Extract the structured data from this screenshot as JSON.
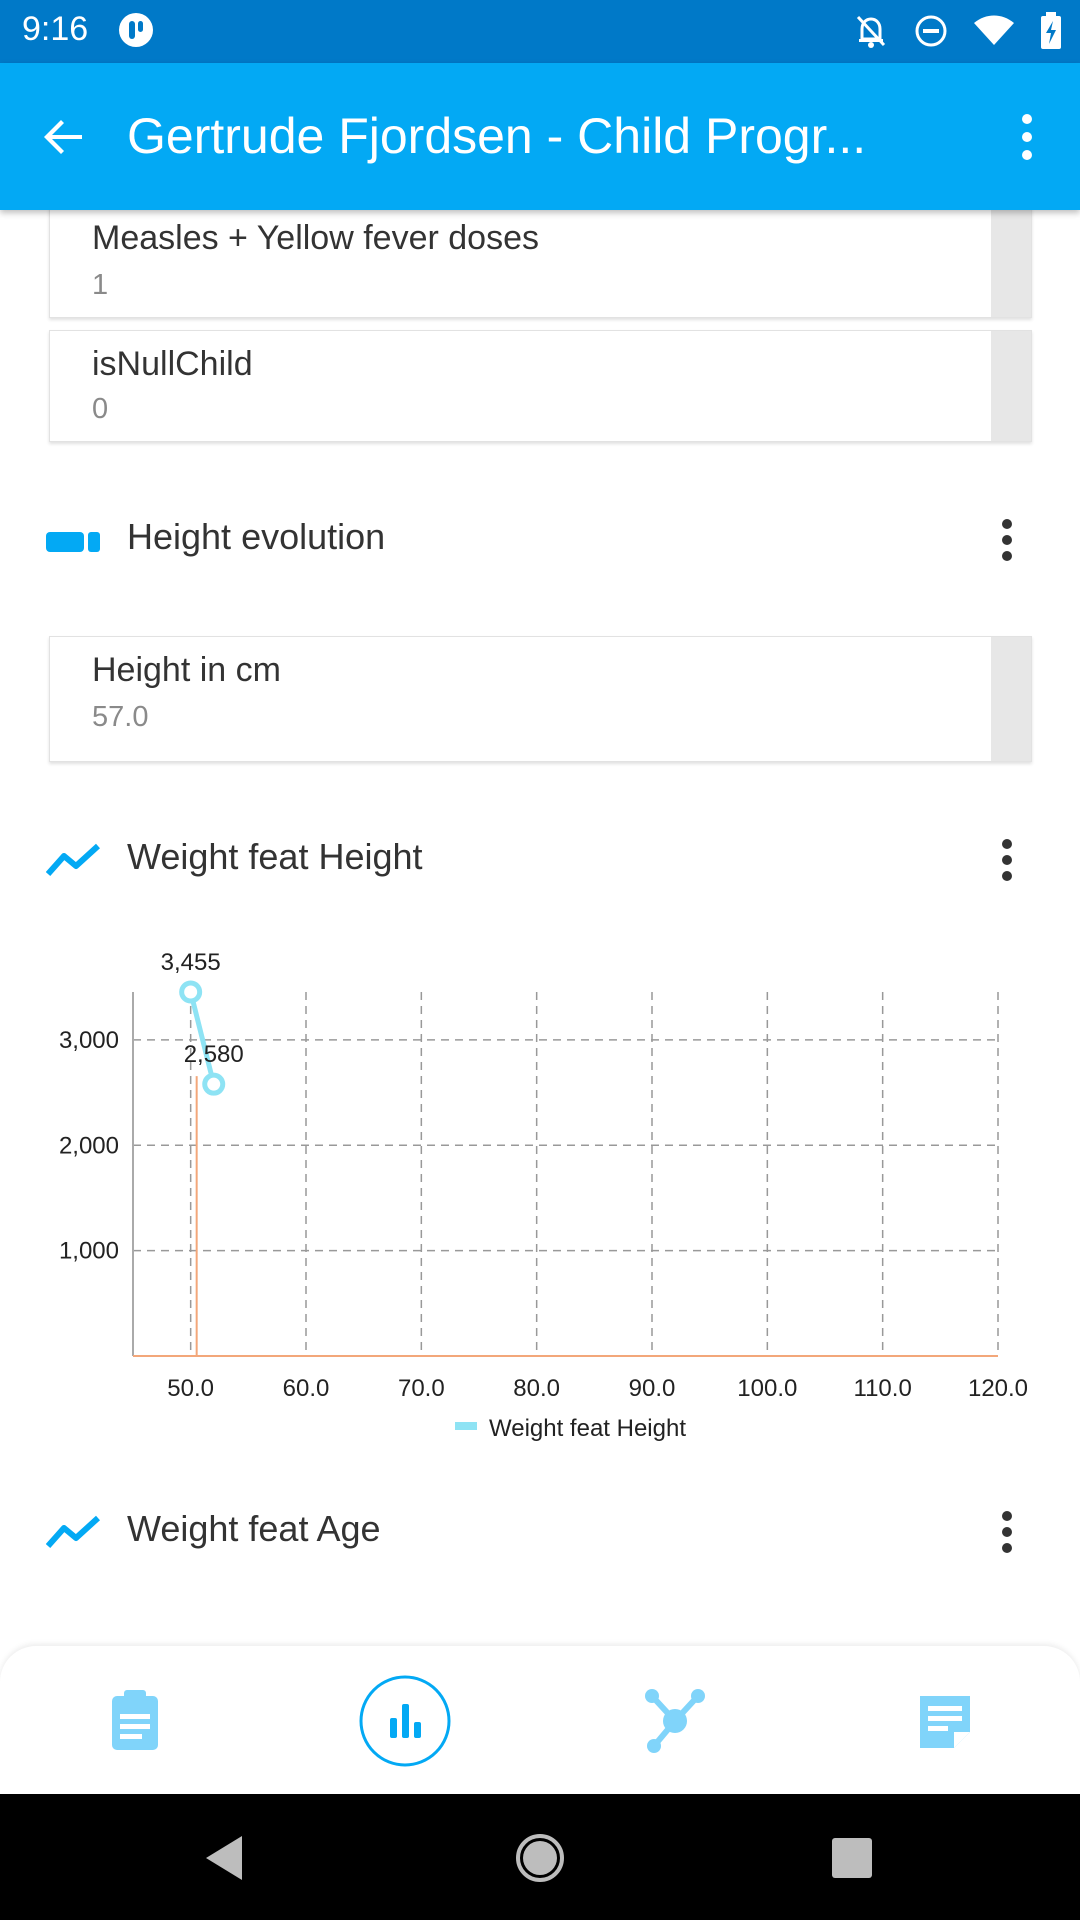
{
  "status": {
    "time": "9:16"
  },
  "toolbar": {
    "title": "Gertrude Fjordsen - Child Progr..."
  },
  "cards": [
    {
      "label": "Measles + Yellow fever doses",
      "value": "1"
    },
    {
      "label": "isNullChild",
      "value": "0"
    },
    {
      "label": "Height in cm",
      "value": "57.0"
    }
  ],
  "sections": {
    "height_evolution": "Height evolution",
    "weight_feat_height": "Weight feat Height",
    "weight_feat_age": "Weight feat Age"
  },
  "colors": {
    "primary": "#03a9f4",
    "status_bar": "#0079c8",
    "series_line": "#8ee3f4",
    "baseline": "#f3a77a"
  },
  "icons": {
    "back": "arrow-left-icon",
    "menu": "more-vert-icon",
    "bar_chart": "bar-chart-icon",
    "line_chart": "line-chart-icon",
    "form": "clipboard-icon",
    "relationships": "network-icon",
    "notes": "notes-icon"
  },
  "chart_data": {
    "type": "line",
    "title": "",
    "xlabel": "",
    "ylabel": "",
    "xlim": [
      45,
      120
    ],
    "ylim": [
      0,
      3455
    ],
    "x_ticks": [
      "50.0",
      "60.0",
      "70.0",
      "80.0",
      "90.0",
      "100.0",
      "110.0",
      "120.0"
    ],
    "y_ticks": [
      "1,000",
      "2,000",
      "3,000"
    ],
    "grid": true,
    "legend": "bottom-center",
    "series": [
      {
        "name": "Weight feat Height",
        "x": [
          50,
          52
        ],
        "y": [
          3455,
          2580
        ],
        "labels": [
          "3,455",
          "2,580"
        ]
      }
    ]
  }
}
